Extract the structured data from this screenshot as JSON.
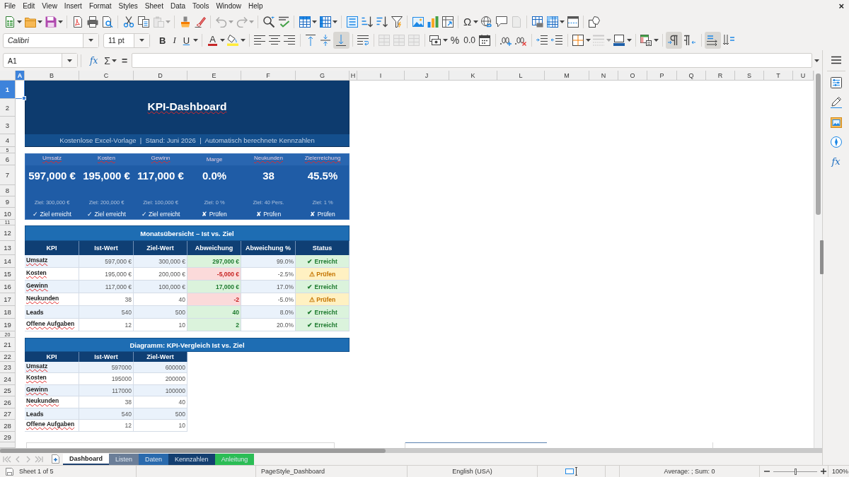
{
  "menu_bar": {
    "items": [
      "File",
      "Edit",
      "View",
      "Insert",
      "Format",
      "Styles",
      "Sheet",
      "Data",
      "Tools",
      "Window",
      "Help"
    ],
    "close_label": "×"
  },
  "standard_toolbar": {
    "paste": {
      "disabled": true
    },
    "undo": {
      "disabled": true
    },
    "redo": {
      "disabled": true
    },
    "special_character": "Ω",
    "headers_footers": {
      "disabled": true
    }
  },
  "formatting_toolbar": {
    "font_name": "Calibri",
    "font_size": "11 pt",
    "bold": "B",
    "italic": "I",
    "underline": "U",
    "font_color": "A",
    "align_bottom": {
      "on": true
    },
    "merge_and_center": {
      "disabled": true
    },
    "merge_cells": {
      "disabled": true
    },
    "unmerge_cells": {
      "disabled": true
    },
    "percent": "%",
    "number": "0.0",
    "border_style": {
      "disabled": true
    },
    "left_to_right": {
      "on": true
    },
    "right_to_left": {
      "on": false
    },
    "horizontal_text": {
      "on": true
    },
    "vertical_text": {
      "on": false
    }
  },
  "formula_bar": {
    "name_box": "A1",
    "function_wizard": "fx",
    "sum": "Σ",
    "equals": "="
  },
  "sheet": {
    "column_headers": [
      {
        "label": "A",
        "selected": true
      },
      {
        "label": "B",
        "selected": false
      },
      {
        "label": "C",
        "selected": false
      },
      {
        "label": "D",
        "selected": false
      },
      {
        "label": "E",
        "selected": false
      },
      {
        "label": "F",
        "selected": false
      },
      {
        "label": "G",
        "selected": false
      },
      {
        "label": "H",
        "selected": false
      },
      {
        "label": "I",
        "selected": false
      },
      {
        "label": "J",
        "selected": false
      },
      {
        "label": "K",
        "selected": false
      },
      {
        "label": "L",
        "selected": false
      },
      {
        "label": "M",
        "selected": false
      },
      {
        "label": "N",
        "selected": false
      },
      {
        "label": "O",
        "selected": false
      },
      {
        "label": "P",
        "selected": false
      },
      {
        "label": "Q",
        "selected": false
      },
      {
        "label": "R",
        "selected": false
      },
      {
        "label": "S",
        "selected": false
      },
      {
        "label": "T",
        "selected": false
      },
      {
        "label": "U",
        "selected": false
      }
    ],
    "row_headers": [
      {
        "label": "1",
        "selected": true
      },
      {
        "label": "2",
        "selected": false
      },
      {
        "label": "3",
        "selected": false
      },
      {
        "label": "4",
        "selected": false
      },
      {
        "label": "5",
        "selected": false
      },
      {
        "label": "6",
        "selected": false
      },
      {
        "label": "7",
        "selected": false
      },
      {
        "label": "8",
        "selected": false
      },
      {
        "label": "9",
        "selected": false
      },
      {
        "label": "10",
        "selected": false
      },
      {
        "label": "11",
        "selected": false
      },
      {
        "label": "12",
        "selected": false
      },
      {
        "label": "13",
        "selected": false
      },
      {
        "label": "14",
        "selected": false
      },
      {
        "label": "15",
        "selected": false
      },
      {
        "label": "16",
        "selected": false
      },
      {
        "label": "17",
        "selected": false
      },
      {
        "label": "18",
        "selected": false
      },
      {
        "label": "19",
        "selected": false
      },
      {
        "label": "20",
        "selected": false
      },
      {
        "label": "21",
        "selected": false
      },
      {
        "label": "22",
        "selected": false
      },
      {
        "label": "23",
        "selected": false
      },
      {
        "label": "24",
        "selected": false
      },
      {
        "label": "25",
        "selected": false
      },
      {
        "label": "26",
        "selected": false
      },
      {
        "label": "27",
        "selected": false
      },
      {
        "label": "28",
        "selected": false
      },
      {
        "label": "29",
        "selected": false
      }
    ],
    "header": {
      "title": "KPI-Dashboard",
      "title_spelling_error": true,
      "subtitle": "Kostenlose Excel-Vorlage  |  Stand: Juni 2026  |  Automatisch berechnete Kennzahlen"
    },
    "kpi_cards": [
      {
        "label": "Umsatz",
        "spelling_error": true,
        "value": "597,000 €",
        "target": "Ziel: 300,000 €",
        "status": "✓ Ziel erreicht"
      },
      {
        "label": "Kosten",
        "spelling_error": true,
        "value": "195,000 €",
        "target": "Ziel: 200,000 €",
        "status": "✓ Ziel erreicht"
      },
      {
        "label": "Gewinn",
        "spelling_error": true,
        "value": "117,000 €",
        "target": "Ziel: 100,000 €",
        "status": "✓ Ziel erreicht"
      },
      {
        "label": "Marge",
        "spelling_error": false,
        "value": "0.0%",
        "target": "Ziel: 0 %",
        "status": "✘ Prüfen"
      },
      {
        "label": "Neukunden",
        "spelling_error": true,
        "value": "38",
        "target": "Ziel: 40 Pers.",
        "status": "✘ Prüfen"
      },
      {
        "label": "Zielerreichung",
        "spelling_error": true,
        "value": "45.5%",
        "target": "Ziel: 1 %",
        "status": "✘ Prüfen"
      }
    ],
    "monthly_table": {
      "title": "Monatsübersicht – Ist vs. Ziel",
      "columns": [
        "KPI",
        "Ist-Wert",
        "Ziel-Wert",
        "Abweichung",
        "Abweichung %",
        "Status"
      ],
      "rows": [
        {
          "kpi": "Umsatz",
          "spelling_error": true,
          "actual": "597,000 €",
          "target": "300,000 €",
          "deviation": "297,000 €",
          "deviation_percent": "99.0%",
          "status": "✔ Erreicht",
          "kind": "good"
        },
        {
          "kpi": "Kosten",
          "spelling_error": true,
          "actual": "195,000 €",
          "target": "200,000 €",
          "deviation": "-5,000 €",
          "deviation_percent": "-2.5%",
          "status": "⚠ Prüfen",
          "kind": "warning"
        },
        {
          "kpi": "Gewinn",
          "spelling_error": true,
          "actual": "117,000 €",
          "target": "100,000 €",
          "deviation": "17,000 €",
          "deviation_percent": "17.0%",
          "status": "✔ Erreicht",
          "kind": "good"
        },
        {
          "kpi": "Neukunden",
          "spelling_error": true,
          "actual": "38",
          "target": "40",
          "deviation": "-2",
          "deviation_percent": "-5.0%",
          "status": "⚠ Prüfen",
          "kind": "warning"
        },
        {
          "kpi": "Leads",
          "spelling_error": false,
          "actual": "540",
          "target": "500",
          "deviation": "40",
          "deviation_percent": "8.0%",
          "status": "✔ Erreicht",
          "kind": "good"
        },
        {
          "kpi": "Offene Aufgaben",
          "spelling_error": true,
          "actual": "12",
          "target": "10",
          "deviation": "2",
          "deviation_percent": "20.0%",
          "status": "✔ Erreicht",
          "kind": "good"
        }
      ]
    },
    "chart_table": {
      "title": "Diagramm: KPI-Vergleich Ist vs. Ziel",
      "columns": [
        "KPI",
        "Ist-Wert",
        "Ziel-Wert"
      ],
      "rows": [
        {
          "kpi": "Umsatz",
          "spelling_error": true,
          "actual": "597000",
          "target": "600000"
        },
        {
          "kpi": "Kosten",
          "spelling_error": true,
          "actual": "195000",
          "target": "200000"
        },
        {
          "kpi": "Gewinn",
          "spelling_error": true,
          "actual": "117000",
          "target": "100000"
        },
        {
          "kpi": "Neukunden",
          "spelling_error": true,
          "actual": "38",
          "target": "40"
        },
        {
          "kpi": "Leads",
          "spelling_error": false,
          "actual": "540",
          "target": "500"
        },
        {
          "kpi": "Offene Aufgaben",
          "spelling_error": true,
          "actual": "12",
          "target": "10"
        }
      ]
    }
  },
  "sheet_tabs": [
    {
      "label": "Dashboard",
      "selected": true
    },
    {
      "label": "Listen",
      "selected": false,
      "color": "#6b7e98"
    },
    {
      "label": "Daten",
      "selected": false,
      "color": "#2a6aad"
    },
    {
      "label": "Kennzahlen",
      "selected": false,
      "color": "#143f70"
    },
    {
      "label": "Anleitung",
      "selected": false,
      "color": "#2bbd55"
    }
  ],
  "sidebar": {
    "functions_label": "fx"
  },
  "status_bar": {
    "sheet_position": "Sheet 1 of 5",
    "page_style": "PageStyle_Dashboard",
    "language": "English (USA)",
    "selection_summary": "Average: ; Sum: 0",
    "zoom": {
      "level": 0.5,
      "reading": "100%"
    }
  }
}
